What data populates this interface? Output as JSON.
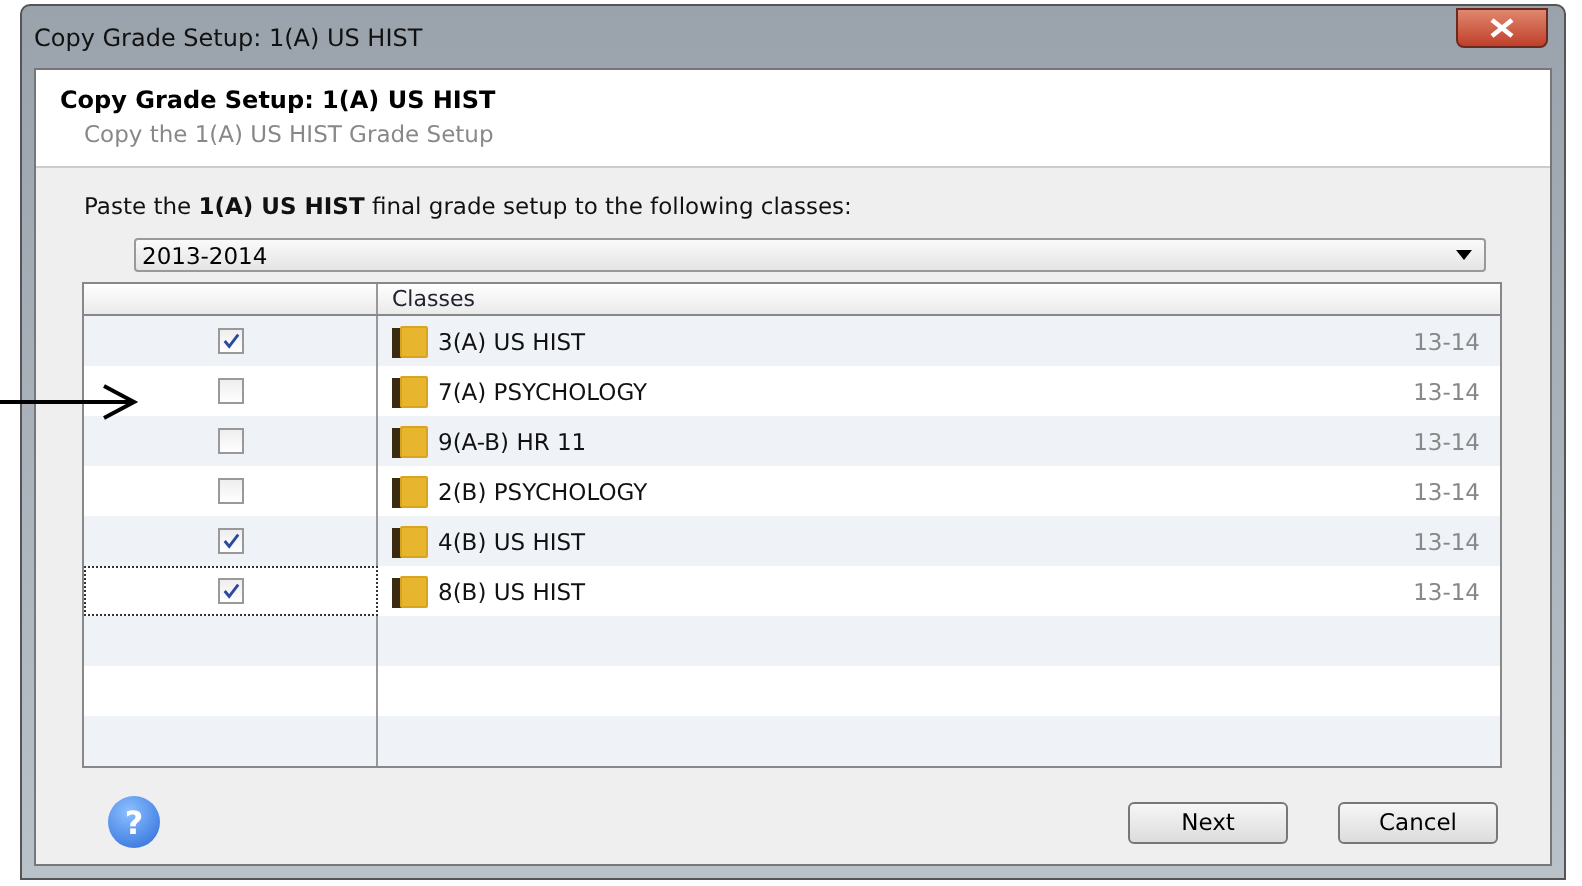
{
  "window": {
    "title": "Copy Grade Setup: 1(A) US HIST"
  },
  "header": {
    "title": "Copy Grade Setup: 1(A) US HIST",
    "subtitle": "Copy the 1(A) US HIST Grade Setup"
  },
  "instruction": "Paste the **1(A) US HIST** final grade setup to the following classes:",
  "year_dropdown": {
    "value": "2013-2014"
  },
  "table": {
    "columns": [
      "Classes"
    ],
    "rows": [
      {
        "checked": true,
        "focused": false,
        "name": "3(A) US HIST",
        "year": "13-14"
      },
      {
        "checked": false,
        "focused": false,
        "name": "7(A) PSYCHOLOGY",
        "year": "13-14"
      },
      {
        "checked": false,
        "focused": false,
        "name": "9(A-B) HR 11",
        "year": "13-14"
      },
      {
        "checked": false,
        "focused": false,
        "name": "2(B) PSYCHOLOGY",
        "year": "13-14"
      },
      {
        "checked": true,
        "focused": false,
        "name": "4(B) US HIST",
        "year": "13-14"
      },
      {
        "checked": true,
        "focused": true,
        "name": "8(B) US HIST",
        "year": "13-14"
      }
    ]
  },
  "help_button": "?",
  "buttons": [
    "Next",
    "Cancel"
  ]
}
